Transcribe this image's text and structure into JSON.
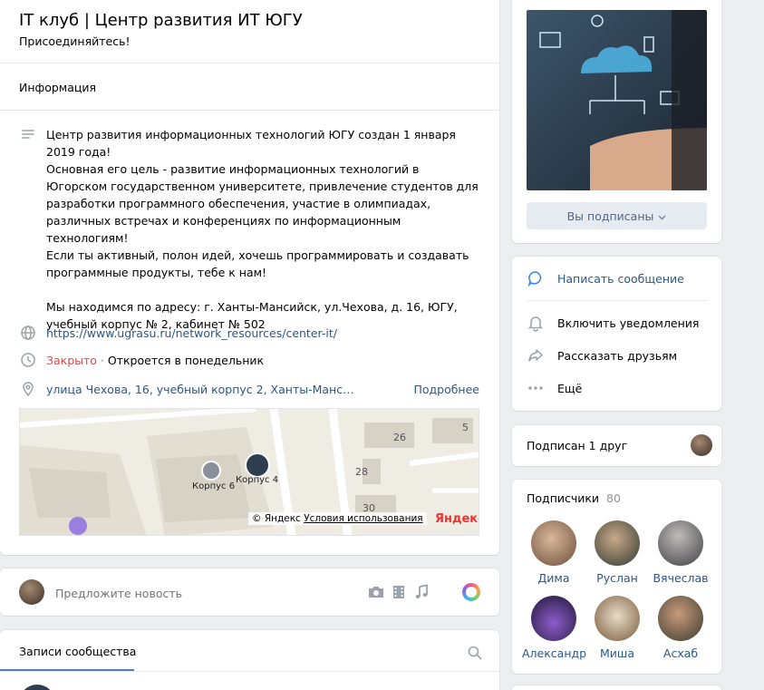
{
  "group": {
    "title": "IT клуб | Центр развития ИТ ЮГУ",
    "status": "Присоединяйтесь!",
    "section": "Информация"
  },
  "info": {
    "description": "Центр развития информационных технологий ЮГУ создан 1 января 2019 года!\nОсновная его цель - развитие информационных технологий в Югорском государственном университете, привлечение студентов для разработки программного обеспечения, участие в олимпиадах, различных встречах и конференциях по информационным технологиям!\nЕсли ты активный, полон идей, хочешь программировать и создавать программные продукты, тебе к нам!\n\nМы находимся по адресу: г. Ханты-Мансийск, ул.Чехова, д. 16, ЮГУ, учебный корпус № 2, кабинет № 502",
    "website": "https://www.ugrasu.ru/network_resources/center-it/",
    "hours_status": "Закрыто",
    "hours_sep": " · ",
    "hours_note": "Откроется в понедельник",
    "address": "улица Чехова, 16, учебный корпус 2, Ханты-Манс…",
    "more": "Подробнее"
  },
  "map": {
    "labels": [
      "26",
      "28",
      "30",
      "5",
      "Корпус 6",
      "Корпус 4"
    ],
    "copyright": "© Яндекс",
    "terms": "Условия использования",
    "brand": "Яндекс"
  },
  "cover": {
    "subscribed_button": "Вы подписаны"
  },
  "actions": [
    {
      "label": "Написать сообщение",
      "icon": "message-icon"
    },
    {
      "label": "Включить уведомления",
      "icon": "bell-icon"
    },
    {
      "label": "Рассказать друзьям",
      "icon": "share-icon"
    },
    {
      "label": "Ещё",
      "icon": "more-icon"
    }
  ],
  "friend": {
    "label": "Подписан 1 друг"
  },
  "subscribers": {
    "title": "Подписчики",
    "count": "80",
    "people": [
      "Дима",
      "Руслан",
      "Вячеслав",
      "Александр",
      "Миша",
      "Асхаб"
    ]
  },
  "suggest": {
    "placeholder": "Предложите новость"
  },
  "posts": {
    "tab": "Записи сообщества"
  },
  "colors": {
    "accent": "#2a5885",
    "closed": "#e64646",
    "button_bg": "#e5ebf1"
  }
}
